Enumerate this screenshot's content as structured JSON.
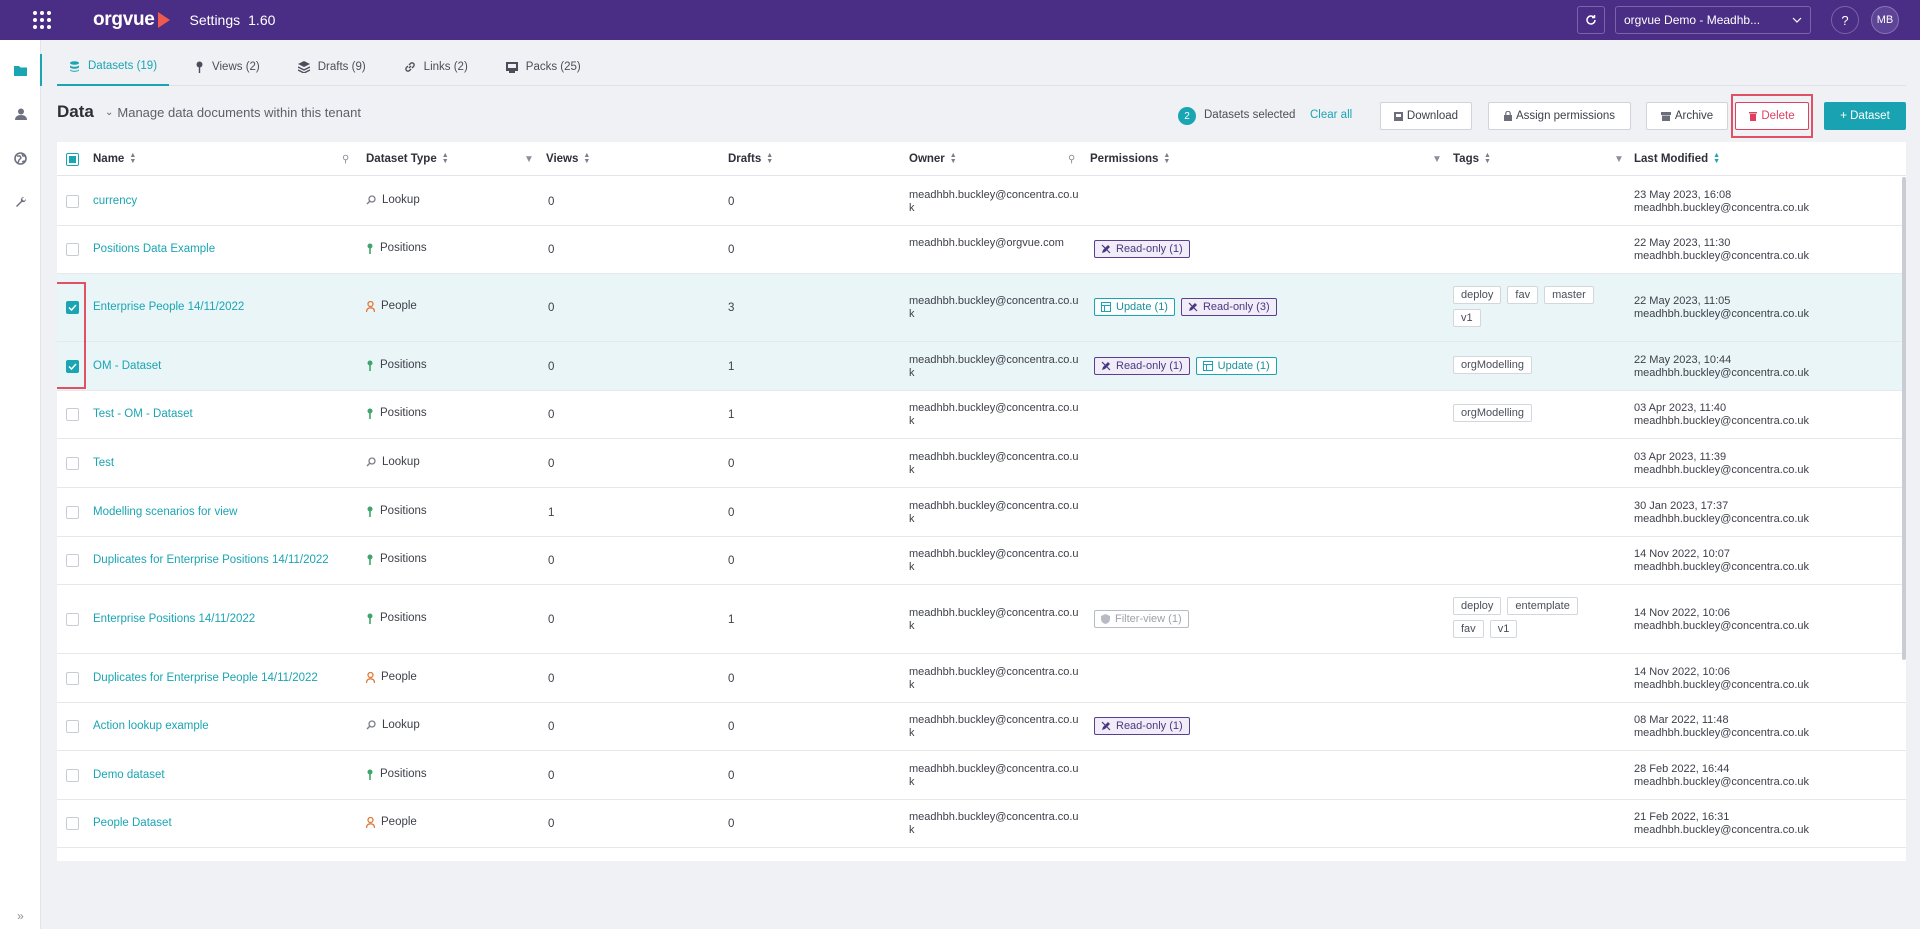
{
  "topbar": {
    "logo_text": "orgvue",
    "app_title": "Settings",
    "version": "1.60",
    "tenant": "orgvue Demo - Meadhb...",
    "help": "?",
    "avatar_initials": "MB"
  },
  "tabs": [
    {
      "label": "Datasets (19)",
      "icon": "datasets-icon",
      "active": true
    },
    {
      "label": "Views (2)",
      "icon": "pin-icon"
    },
    {
      "label": "Drafts (9)",
      "icon": "layers-icon"
    },
    {
      "label": "Links (2)",
      "icon": "link-icon"
    },
    {
      "label": "Packs (25)",
      "icon": "pack-icon"
    }
  ],
  "header": {
    "title": "Data",
    "subtitle": "Manage data documents within this tenant",
    "selected_count": "2",
    "selected_label": "Datasets selected",
    "clear_all": "Clear all",
    "download": "Download",
    "assign_permissions": "Assign permissions",
    "archive": "Archive",
    "delete": "Delete",
    "add_dataset": "+ Dataset"
  },
  "columns": {
    "name": "Name",
    "type": "Dataset Type",
    "views": "Views",
    "drafts": "Drafts",
    "owner": "Owner",
    "permissions": "Permissions",
    "tags": "Tags",
    "modified": "Last Modified"
  },
  "rows": [
    {
      "name": "currency",
      "type": "Lookup",
      "views": "0",
      "drafts": "0",
      "owner": "meadhbh.buckley@concentra.co.uk",
      "perms": [],
      "tags": [],
      "date": "23 May 2023, 16:08",
      "by": "meadhbh.buckley@concentra.co.uk",
      "checked": false
    },
    {
      "name": "Positions Data Example",
      "type": "Positions",
      "views": "0",
      "drafts": "0",
      "owner": "meadhbh.buckley@orgvue.com",
      "perms": [
        "Read-only (1)"
      ],
      "tags": [],
      "date": "22 May 2023, 11:30",
      "by": "meadhbh.buckley@concentra.co.uk",
      "checked": false
    },
    {
      "name": "Enterprise People 14/11/2022",
      "type": "People",
      "views": "0",
      "drafts": "3",
      "owner": "meadhbh.buckley@concentra.co.uk",
      "perms": [
        "Update (1)",
        "Read-only (3)"
      ],
      "tags": [
        "deploy",
        "fav",
        "master",
        "v1"
      ],
      "date": "22 May 2023, 11:05",
      "by": "meadhbh.buckley@concentra.co.uk",
      "checked": true
    },
    {
      "name": "OM - Dataset",
      "type": "Positions",
      "views": "0",
      "drafts": "1",
      "owner": "meadhbh.buckley@concentra.co.uk",
      "perms": [
        "Read-only (1)",
        "Update (1)"
      ],
      "tags": [
        "orgModelling"
      ],
      "date": "22 May 2023, 10:44",
      "by": "meadhbh.buckley@concentra.co.uk",
      "checked": true
    },
    {
      "name": "Test - OM - Dataset",
      "type": "Positions",
      "views": "0",
      "drafts": "1",
      "owner": "meadhbh.buckley@concentra.co.uk",
      "perms": [],
      "tags": [
        "orgModelling"
      ],
      "date": "03 Apr 2023, 11:40",
      "by": "meadhbh.buckley@concentra.co.uk",
      "checked": false
    },
    {
      "name": "Test",
      "type": "Lookup",
      "views": "0",
      "drafts": "0",
      "owner": "meadhbh.buckley@concentra.co.uk",
      "perms": [],
      "tags": [],
      "date": "03 Apr 2023, 11:39",
      "by": "meadhbh.buckley@concentra.co.uk",
      "checked": false
    },
    {
      "name": "Modelling scenarios for view",
      "type": "Positions",
      "views": "1",
      "drafts": "0",
      "owner": "meadhbh.buckley@concentra.co.uk",
      "perms": [],
      "tags": [],
      "date": "30 Jan 2023, 17:37",
      "by": "meadhbh.buckley@concentra.co.uk",
      "checked": false
    },
    {
      "name": "Duplicates for Enterprise Positions 14/11/2022",
      "type": "Positions",
      "views": "0",
      "drafts": "0",
      "owner": "meadhbh.buckley@concentra.co.uk",
      "perms": [],
      "tags": [],
      "date": "14 Nov 2022, 10:07",
      "by": "meadhbh.buckley@concentra.co.uk",
      "checked": false
    },
    {
      "name": "Enterprise Positions 14/11/2022",
      "type": "Positions",
      "views": "0",
      "drafts": "1",
      "owner": "meadhbh.buckley@concentra.co.uk",
      "perms": [
        "Filter-view (1)"
      ],
      "tags": [
        "deploy",
        "entemplate",
        "fav",
        "v1"
      ],
      "date": "14 Nov 2022, 10:06",
      "by": "meadhbh.buckley@concentra.co.uk",
      "checked": false
    },
    {
      "name": "Duplicates for Enterprise People 14/11/2022",
      "type": "People",
      "views": "0",
      "drafts": "0",
      "owner": "meadhbh.buckley@concentra.co.uk",
      "perms": [],
      "tags": [],
      "date": "14 Nov 2022, 10:06",
      "by": "meadhbh.buckley@concentra.co.uk",
      "checked": false
    },
    {
      "name": "Action lookup example",
      "type": "Lookup",
      "views": "0",
      "drafts": "0",
      "owner": "meadhbh.buckley@concentra.co.uk",
      "perms": [
        "Read-only (1)"
      ],
      "tags": [],
      "date": "08 Mar 2022, 11:48",
      "by": "meadhbh.buckley@concentra.co.uk",
      "checked": false
    },
    {
      "name": "Demo dataset",
      "type": "Positions",
      "views": "0",
      "drafts": "0",
      "owner": "meadhbh.buckley@concentra.co.uk",
      "perms": [],
      "tags": [],
      "date": "28 Feb 2022, 16:44",
      "by": "meadhbh.buckley@concentra.co.uk",
      "checked": false
    },
    {
      "name": "People Dataset",
      "type": "People",
      "views": "0",
      "drafts": "0",
      "owner": "meadhbh.buckley@concentra.co.uk",
      "perms": [],
      "tags": [],
      "date": "21 Feb 2022, 16:31",
      "by": "meadhbh.buckley@concentra.co.uk",
      "checked": false
    }
  ],
  "colors": {
    "brand": "#4a2d84",
    "accent": "#1aa5b3",
    "danger": "#e04060"
  }
}
